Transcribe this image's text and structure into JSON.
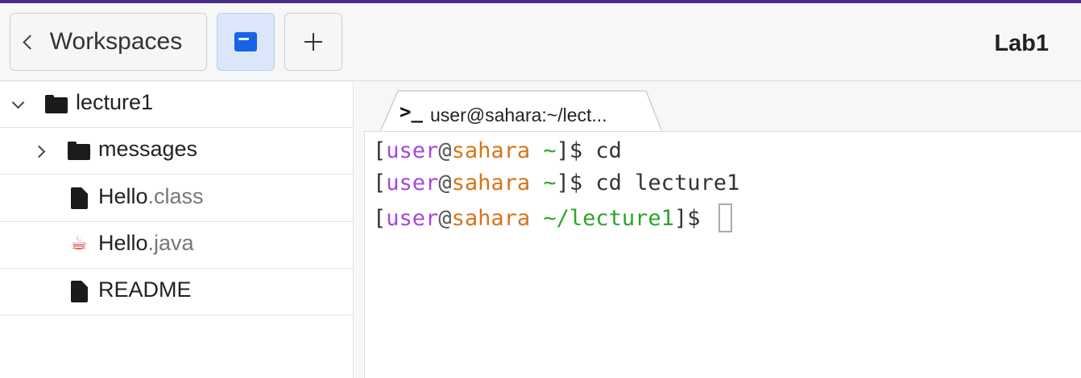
{
  "toolbar": {
    "back_label": "Workspaces",
    "files_icon": "files-icon",
    "add_icon": "plus-icon",
    "title": "Lab1"
  },
  "colors": {
    "accent_bar": "#4b2c85",
    "files_button_active": "#1763e8",
    "prompt_user": "#a347e0",
    "prompt_host": "#d9731b",
    "prompt_path": "#2aa52a"
  },
  "sidebar": {
    "items": [
      {
        "label": "lecture1",
        "ext": "",
        "type": "folder",
        "expanded": true
      },
      {
        "label": "messages",
        "ext": "",
        "type": "folder",
        "expanded": false
      },
      {
        "label": "Hello",
        "ext": ".class",
        "type": "file"
      },
      {
        "label": "Hello",
        "ext": ".java",
        "type": "java-file"
      },
      {
        "label": "README",
        "ext": "",
        "type": "file"
      }
    ]
  },
  "terminal": {
    "tab_label": "user@sahara:~/lect...",
    "tab_icon": "terminal-icon",
    "lines": [
      {
        "open": "[",
        "user": "user",
        "at": "@",
        "host": "sahara",
        "path": " ~",
        "close": "]$ ",
        "cmd": "cd"
      },
      {
        "open": "[",
        "user": "user",
        "at": "@",
        "host": "sahara",
        "path": " ~",
        "close": "]$ ",
        "cmd": "cd lecture1"
      },
      {
        "open": "[",
        "user": "user",
        "at": "@",
        "host": "sahara",
        "path": " ~/lecture1",
        "close": "]$ ",
        "cmd": ""
      }
    ]
  }
}
